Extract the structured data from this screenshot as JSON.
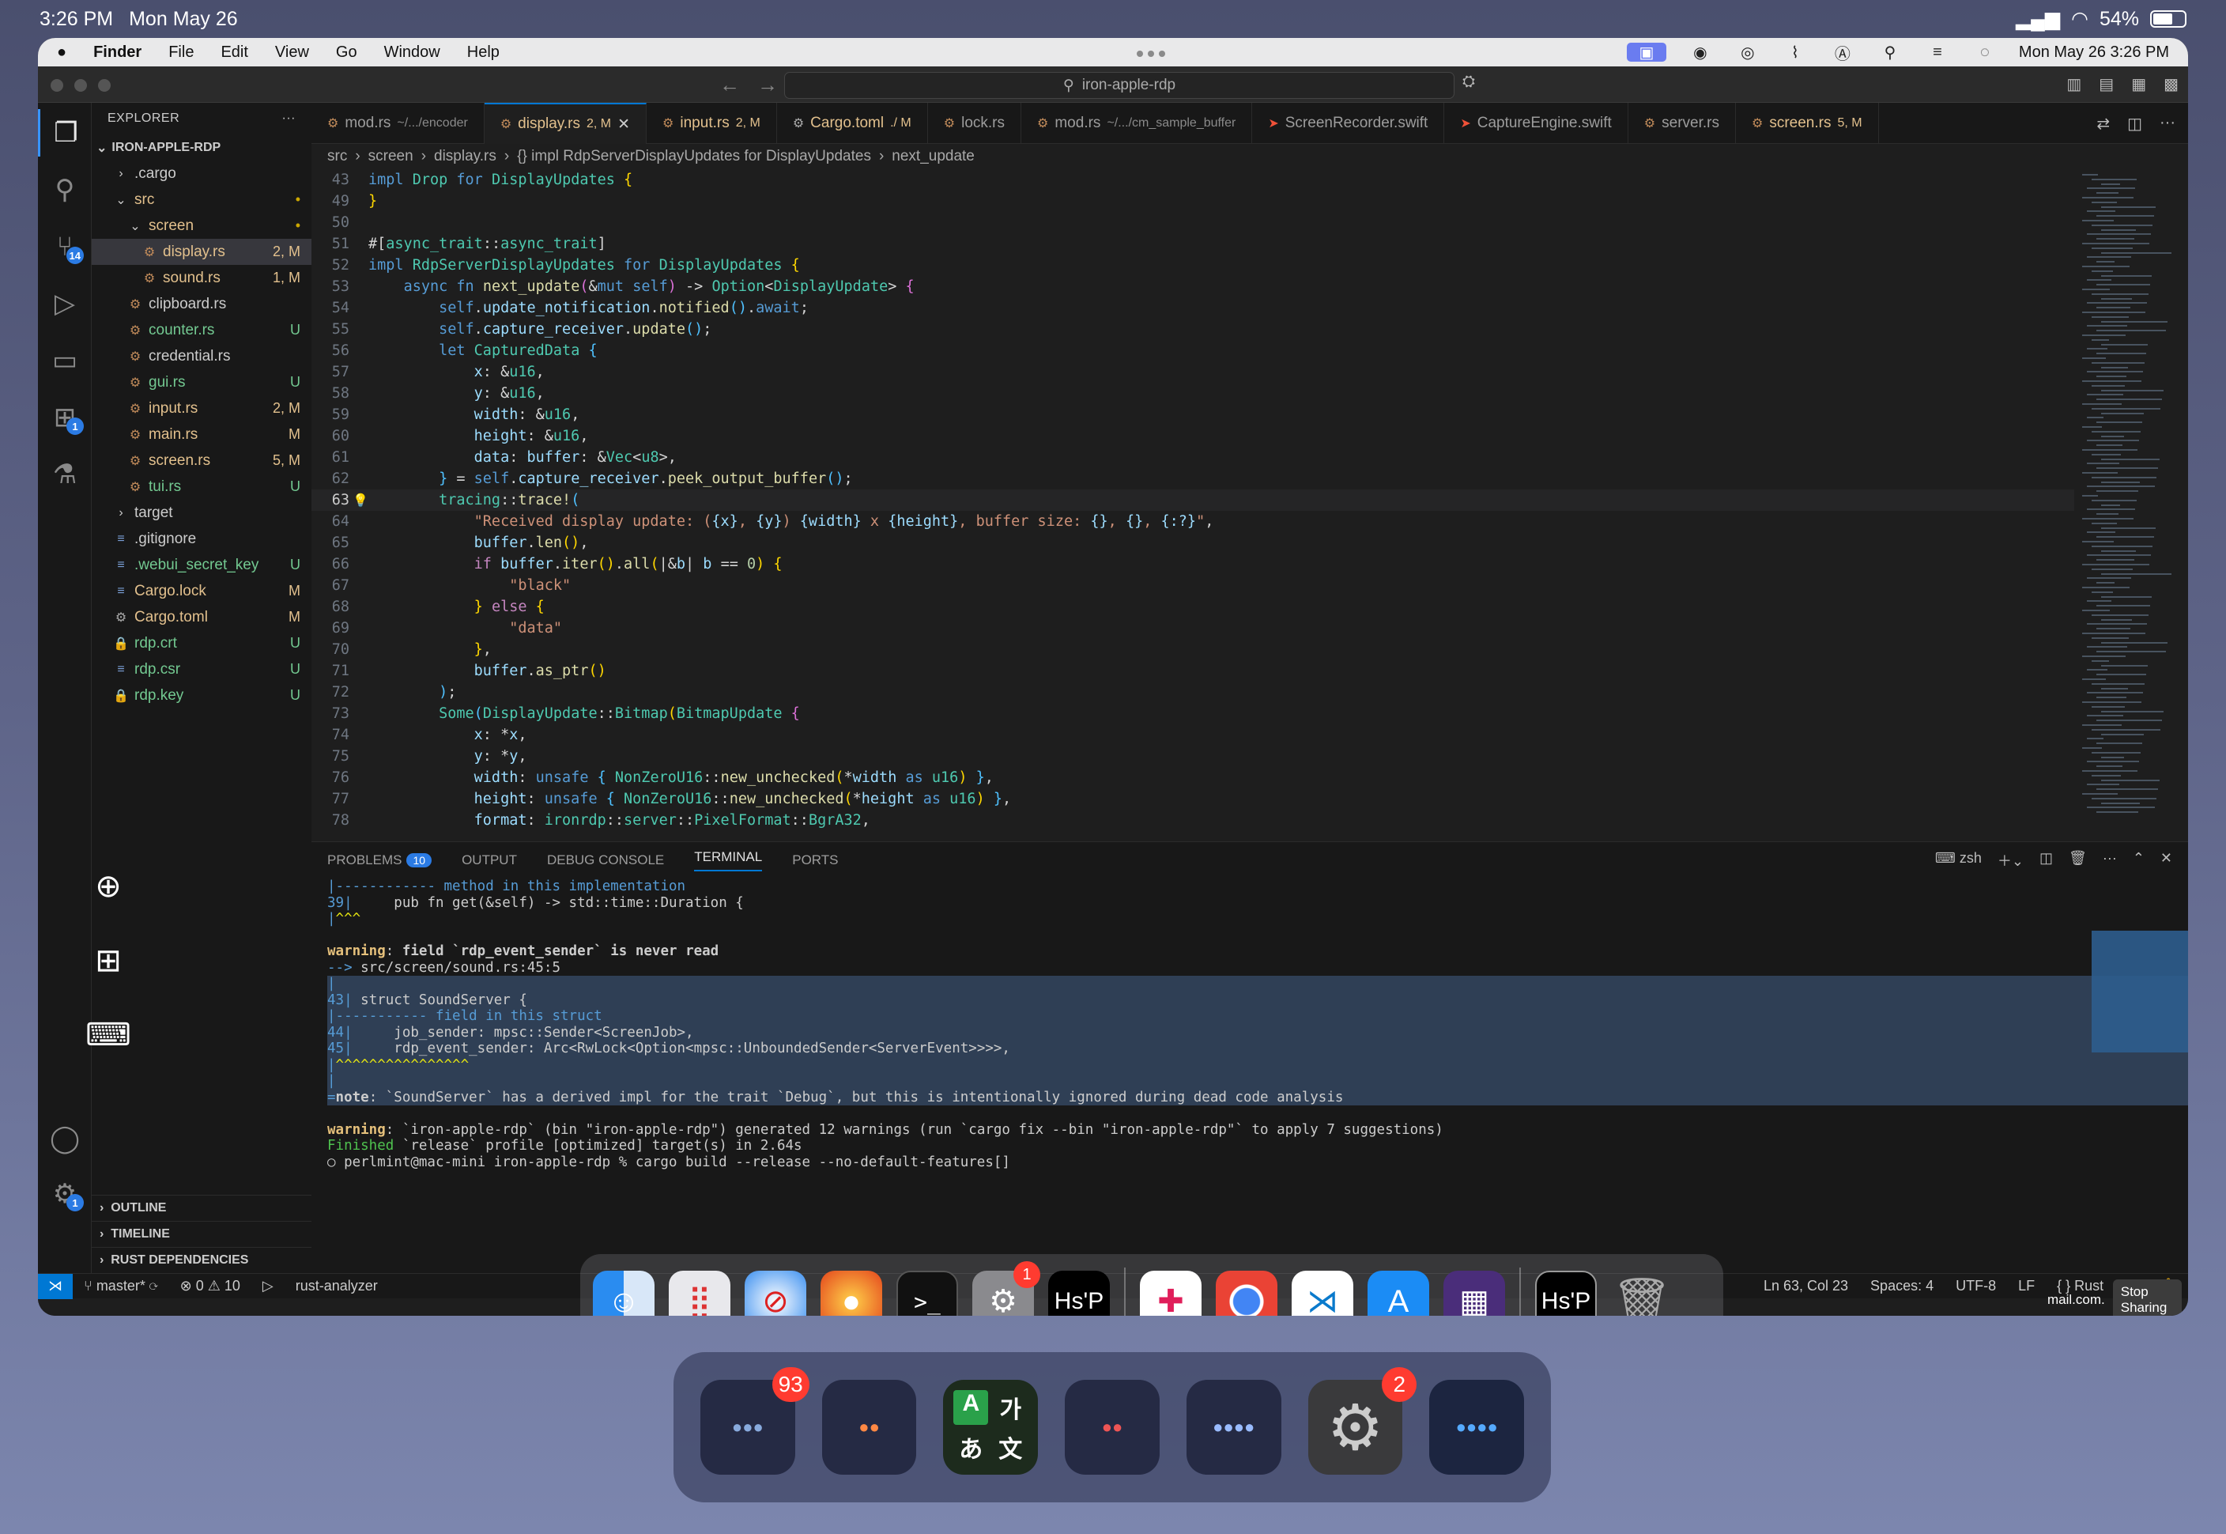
{
  "ipad_status": {
    "time": "3:26 PM",
    "date": "Mon May 26",
    "battery": "54%"
  },
  "menubar": {
    "app": "Finder",
    "items": [
      "File",
      "Edit",
      "View",
      "Go",
      "Window",
      "Help"
    ],
    "clock": "Mon May 26  3:26 PM"
  },
  "titlebar": {
    "search": "iron-apple-rdp"
  },
  "activity_badges": {
    "scm": "14",
    "extensions": "1",
    "settings": "1"
  },
  "explorer": {
    "title": "EXPLORER",
    "root": "IRON-APPLE-RDP",
    "items": [
      {
        "label": ".cargo",
        "indent": 1,
        "kind": "folder-closed",
        "status": ""
      },
      {
        "label": "src",
        "indent": 1,
        "kind": "folder-open",
        "status": "•"
      },
      {
        "label": "screen",
        "indent": 2,
        "kind": "folder-open",
        "status": "•"
      },
      {
        "label": "display.rs",
        "indent": 3,
        "kind": "rs",
        "status": "2, M",
        "selected": true
      },
      {
        "label": "sound.rs",
        "indent": 3,
        "kind": "rs",
        "status": "1, M"
      },
      {
        "label": "clipboard.rs",
        "indent": 2,
        "kind": "rs",
        "status": ""
      },
      {
        "label": "counter.rs",
        "indent": 2,
        "kind": "rs",
        "status": "U"
      },
      {
        "label": "credential.rs",
        "indent": 2,
        "kind": "rs",
        "status": ""
      },
      {
        "label": "gui.rs",
        "indent": 2,
        "kind": "rs",
        "status": "U"
      },
      {
        "label": "input.rs",
        "indent": 2,
        "kind": "rs",
        "status": "2, M"
      },
      {
        "label": "main.rs",
        "indent": 2,
        "kind": "rs",
        "status": "M"
      },
      {
        "label": "screen.rs",
        "indent": 2,
        "kind": "rs",
        "status": "5, M"
      },
      {
        "label": "tui.rs",
        "indent": 2,
        "kind": "rs",
        "status": "U"
      },
      {
        "label": "target",
        "indent": 1,
        "kind": "folder-closed",
        "status": ""
      },
      {
        "label": ".gitignore",
        "indent": 1,
        "kind": "txt",
        "status": ""
      },
      {
        "label": ".webui_secret_key",
        "indent": 1,
        "kind": "txt",
        "status": "U"
      },
      {
        "label": "Cargo.lock",
        "indent": 1,
        "kind": "txt",
        "status": "M"
      },
      {
        "label": "Cargo.toml",
        "indent": 1,
        "kind": "gear",
        "status": "M"
      },
      {
        "label": "rdp.crt",
        "indent": 1,
        "kind": "lock",
        "status": "U"
      },
      {
        "label": "rdp.csr",
        "indent": 1,
        "kind": "txt",
        "status": "U"
      },
      {
        "label": "rdp.key",
        "indent": 1,
        "kind": "lock",
        "status": "U"
      }
    ],
    "sections": [
      "OUTLINE",
      "TIMELINE",
      "RUST DEPENDENCIES"
    ]
  },
  "tabs": [
    {
      "label": "mod.rs",
      "sub": "~/.../encoder",
      "status": ""
    },
    {
      "label": "display.rs",
      "sub": "",
      "status": "2, M",
      "active": true
    },
    {
      "label": "input.rs",
      "sub": "",
      "status": "2, M"
    },
    {
      "label": "Cargo.toml",
      "sub": "",
      "status": "./ M"
    },
    {
      "label": "lock.rs",
      "sub": "",
      "status": ""
    },
    {
      "label": "mod.rs",
      "sub": "~/.../cm_sample_buffer",
      "status": ""
    },
    {
      "label": "ScreenRecorder.swift",
      "sub": "",
      "status": ""
    },
    {
      "label": "CaptureEngine.swift",
      "sub": "",
      "status": ""
    },
    {
      "label": "server.rs",
      "sub": "",
      "status": ""
    },
    {
      "label": "screen.rs",
      "sub": "",
      "status": "5, M"
    }
  ],
  "breadcrumb": [
    "src",
    "screen",
    "display.rs",
    "{} impl RdpServerDisplayUpdates for DisplayUpdates",
    "next_update"
  ],
  "code_lines": [
    {
      "n": "43",
      "html": "<span class='k'>impl</span> <span class='t'>Drop</span> <span class='k'>for</span> <span class='t'>DisplayUpdates</span> <span class='y'>{</span>"
    },
    {
      "n": "49",
      "html": "<span class='y'>}</span>"
    },
    {
      "n": "50",
      "html": ""
    },
    {
      "n": "51",
      "html": "#[<span class='t'>async_trait</span>::<span class='t'>async_trait</span>]"
    },
    {
      "n": "52",
      "html": "<span class='k'>impl</span> <span class='t'>RdpServerDisplayUpdates</span> <span class='k'>for</span> <span class='t'>DisplayUpdates</span> <span class='y'>{</span>"
    },
    {
      "n": "53",
      "html": "    <span class='k'>async</span> <span class='k'>fn</span> <span class='f'>next_update</span><span class='p'>(</span>&amp;<span class='k'>mut</span> <span class='k'>self</span><span class='p'>)</span> -&gt; <span class='t'>Option</span>&lt;<span class='t'>DisplayUpdate</span>&gt; <span class='p'>{</span>"
    },
    {
      "n": "54",
      "html": "        <span class='k'>self</span>.<span class='v'>update_notification</span>.<span class='f'>notified</span><span class='m'>()</span>.<span class='k'>await</span>;"
    },
    {
      "n": "55",
      "html": "        <span class='k'>self</span>.<span class='v'>capture_receiver</span>.<span class='f'>update</span><span class='m'>()</span>;"
    },
    {
      "n": "56",
      "html": "        <span class='k'>let</span> <span class='t'>CapturedData</span> <span class='m'>{</span>"
    },
    {
      "n": "57",
      "html": "            <span class='v'>x</span>: &amp;<span class='t'>u16</span>,"
    },
    {
      "n": "58",
      "html": "            <span class='v'>y</span>: &amp;<span class='t'>u16</span>,"
    },
    {
      "n": "59",
      "html": "            <span class='v'>width</span>: &amp;<span class='t'>u16</span>,"
    },
    {
      "n": "60",
      "html": "            <span class='v'>height</span>: &amp;<span class='t'>u16</span>,"
    },
    {
      "n": "61",
      "html": "            <span class='v'>data</span>: <span class='v'>buffer</span>: &amp;<span class='t'>Vec</span>&lt;<span class='t'>u8</span>&gt;,"
    },
    {
      "n": "62",
      "html": "        <span class='m'>}</span> = <span class='k'>self</span>.<span class='v'>capture_receiver</span>.<span class='f'>peek_output_buffer</span><span class='m'>()</span>;"
    },
    {
      "n": "63",
      "html": "        <span class='t'>tracing</span>::<span class='f'>trace!</span><span class='m'>(</span>",
      "cur": true
    },
    {
      "n": "64",
      "html": "            <span class='s'>\"Received display update: (</span><span class='v'>{x}</span><span class='s'>, </span><span class='v'>{y}</span><span class='s'>) </span><span class='v'>{width}</span><span class='s'> x </span><span class='v'>{height}</span><span class='s'>, buffer size: </span><span class='v'>{}</span><span class='s'>, </span><span class='v'>{}</span><span class='s'>, </span><span class='v'>{:?}</span><span class='s'>\"</span>,"
    },
    {
      "n": "65",
      "html": "            <span class='v'>buffer</span>.<span class='f'>len</span><span class='y'>()</span>,"
    },
    {
      "n": "66",
      "html": "            <span class='kc'>if</span> <span class='v'>buffer</span>.<span class='f'>iter</span><span class='y'>()</span>.<span class='f'>all</span><span class='y'>(</span>|&amp;<span class='v'>b</span>| <span class='v'>b</span> == <span class='n'>0</span><span class='y'>)</span> <span class='y'>{</span>"
    },
    {
      "n": "67",
      "html": "                <span class='s'>\"black\"</span>"
    },
    {
      "n": "68",
      "html": "            <span class='y'>}</span> <span class='kc'>else</span> <span class='y'>{</span>"
    },
    {
      "n": "69",
      "html": "                <span class='s'>\"data\"</span>"
    },
    {
      "n": "70",
      "html": "            <span class='y'>}</span>,"
    },
    {
      "n": "71",
      "html": "            <span class='v'>buffer</span>.<span class='f'>as_ptr</span><span class='y'>()</span>"
    },
    {
      "n": "72",
      "html": "        <span class='m'>)</span>;"
    },
    {
      "n": "73",
      "html": "        <span class='t'>Some</span><span class='m'>(</span><span class='t'>DisplayUpdate</span>::<span class='t'>Bitmap</span><span class='y'>(</span><span class='t'>BitmapUpdate</span> <span class='p'>{</span>"
    },
    {
      "n": "74",
      "html": "            <span class='v'>x</span>: *<span class='v'>x</span>,"
    },
    {
      "n": "75",
      "html": "            <span class='v'>y</span>: *<span class='v'>y</span>,"
    },
    {
      "n": "76",
      "html": "            <span class='v'>width</span>: <span class='k'>unsafe</span> <span class='m'>{</span> <span class='t'>NonZeroU16</span>::<span class='f'>new_unchecked</span><span class='y'>(</span>*<span class='v'>width</span> <span class='k'>as</span> <span class='t'>u16</span><span class='y'>)</span> <span class='m'>}</span>,"
    },
    {
      "n": "77",
      "html": "            <span class='v'>height</span>: <span class='k'>unsafe</span> <span class='m'>{</span> <span class='t'>NonZeroU16</span>::<span class='f'>new_unchecked</span><span class='y'>(</span>*<span class='v'>height</span> <span class='k'>as</span> <span class='t'>u16</span><span class='y'>)</span> <span class='m'>}</span>,"
    },
    {
      "n": "78",
      "html": "            <span class='v'>format</span>: <span class='t'>ironrdp</span>::<span class='t'>server</span>::<span class='t'>PixelFormat</span>::<span class='t'>BgrA32</span>,"
    }
  ],
  "panel": {
    "tabs": [
      "PROBLEMS",
      "OUTPUT",
      "DEBUG CONSOLE",
      "TERMINAL",
      "PORTS"
    ],
    "problems_count": "10",
    "shell": "zsh",
    "terminal_lines": [
      {
        "html": "   <span class='tb'>|</span>   <span class='tb'>------------ method in this implementation</span>"
      },
      {
        "html": "<span class='tb'>39</span> <span class='tb'>|</span>     pub fn get(&amp;self) -&gt; std::time::Duration {"
      },
      {
        "html": "   <span class='tb'>|</span>            <span class='tyel'>^^^</span>"
      },
      {
        "html": ""
      },
      {
        "html": "<span class='tw'>warning</span>: <b>field `rdp_event_sender` is never read</b>"
      },
      {
        "html": "  <span class='tb'>--&gt;</span> src/screen/sound.rs:45:5"
      },
      {
        "html": "   <span class='tb'>|</span>",
        "sel": true
      },
      {
        "html": "<span class='tb'>43</span> <span class='tb'>|</span> struct SoundServer {",
        "sel": true
      },
      {
        "html": "   <span class='tb'>|</span>        <span class='tb'>----------- field in this struct</span>",
        "sel": true
      },
      {
        "html": "<span class='tb'>44</span> <span class='tb'>|</span>     job_sender: mpsc::Sender&lt;ScreenJob&gt;,",
        "sel": true
      },
      {
        "html": "<span class='tb'>45</span> <span class='tb'>|</span>     rdp_event_sender: Arc&lt;RwLock&lt;Option&lt;mpsc::UnboundedSender&lt;ServerEvent&gt;&gt;&gt;&gt;,",
        "sel": true
      },
      {
        "html": "   <span class='tb'>|</span>     <span class='tyel'>^^^^^^^^^^^^^^^^</span>",
        "sel": true
      },
      {
        "html": "   <span class='tb'>|</span>",
        "sel": true
      },
      {
        "html": "   <span class='tb'>=</span> <b>note</b>: `SoundServer` has a derived impl for the trait `Debug`, but this is intentionally ignored during dead code analysis",
        "sel": true
      },
      {
        "html": ""
      },
      {
        "html": "<span class='tw'>warning</span>: `iron-apple-rdp` (bin \"iron-apple-rdp\") generated 12 warnings (run `cargo fix --bin \"iron-apple-rdp\"` to apply 7 suggestions)"
      },
      {
        "html": "    <span class='tg'>Finished</span> `release` profile [optimized] target(s) in 2.64s"
      },
      {
        "html": "○ perlmint@mac-mini iron-apple-rdp % cargo build --release --no-default-features[]"
      }
    ]
  },
  "statusbar": {
    "branch": "master*",
    "errors": "0",
    "warnings": "10",
    "analyzer": "rust-analyzer",
    "position": "Ln 63, Col 23",
    "spaces": "Spaces: 4",
    "encoding": "UTF-8",
    "eol": "LF",
    "language": "{ } Rust"
  },
  "dock": {
    "settings_badge": "1",
    "apps": [
      "Finder",
      "Launchpad",
      "Safari",
      "Firefox",
      "Terminal",
      "System Settings",
      "Hs'P",
      "Slack",
      "Chrome",
      "VS Code",
      "App Store",
      "Screen Recorder",
      "Hs'P",
      "Trash"
    ]
  },
  "sharing": {
    "email_suffix": "mail.com.",
    "stop_label": "Stop Sharing"
  },
  "shelf": {
    "badge1": "93",
    "badge2": "2"
  },
  "translate_icon": {
    "a": "A",
    "ga": "가",
    "a_jp": "あ",
    "wen": "文"
  }
}
